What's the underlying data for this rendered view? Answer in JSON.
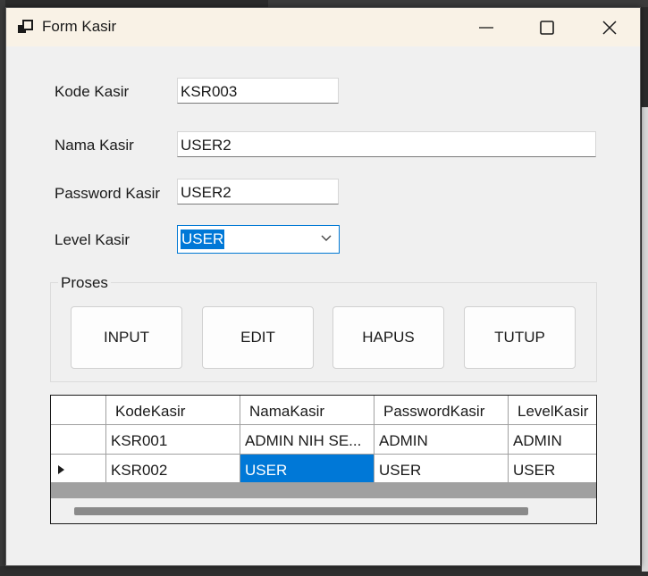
{
  "window": {
    "title": "Form Kasir"
  },
  "form": {
    "kode_label": "Kode Kasir",
    "kode_value": "KSR003",
    "nama_label": "Nama Kasir",
    "nama_value": "USER2",
    "password_label": "Password Kasir",
    "password_value": "USER2",
    "level_label": "Level Kasir",
    "level_value": "USER"
  },
  "proses": {
    "caption": "Proses",
    "buttons": [
      "INPUT",
      "EDIT",
      "HAPUS",
      "TUTUP"
    ]
  },
  "grid": {
    "columns": [
      "KodeKasir",
      "NamaKasir",
      "PasswordKasir",
      "LevelKasir"
    ],
    "rows": [
      [
        "KSR001",
        "ADMIN NIH SE...",
        "ADMIN",
        "ADMIN"
      ],
      [
        "KSR002",
        "USER",
        "USER",
        "USER"
      ]
    ],
    "current_row": 1,
    "selected_cell": "NamaKasir"
  },
  "colors": {
    "accent": "#0078d7",
    "title_bar": "#f9f2e6",
    "window_bg": "#f0f0f0"
  },
  "icons": [
    "app-icon",
    "minimize-icon",
    "maximize-icon",
    "close-icon",
    "chevron-down-icon",
    "row-indicator-icon"
  ]
}
